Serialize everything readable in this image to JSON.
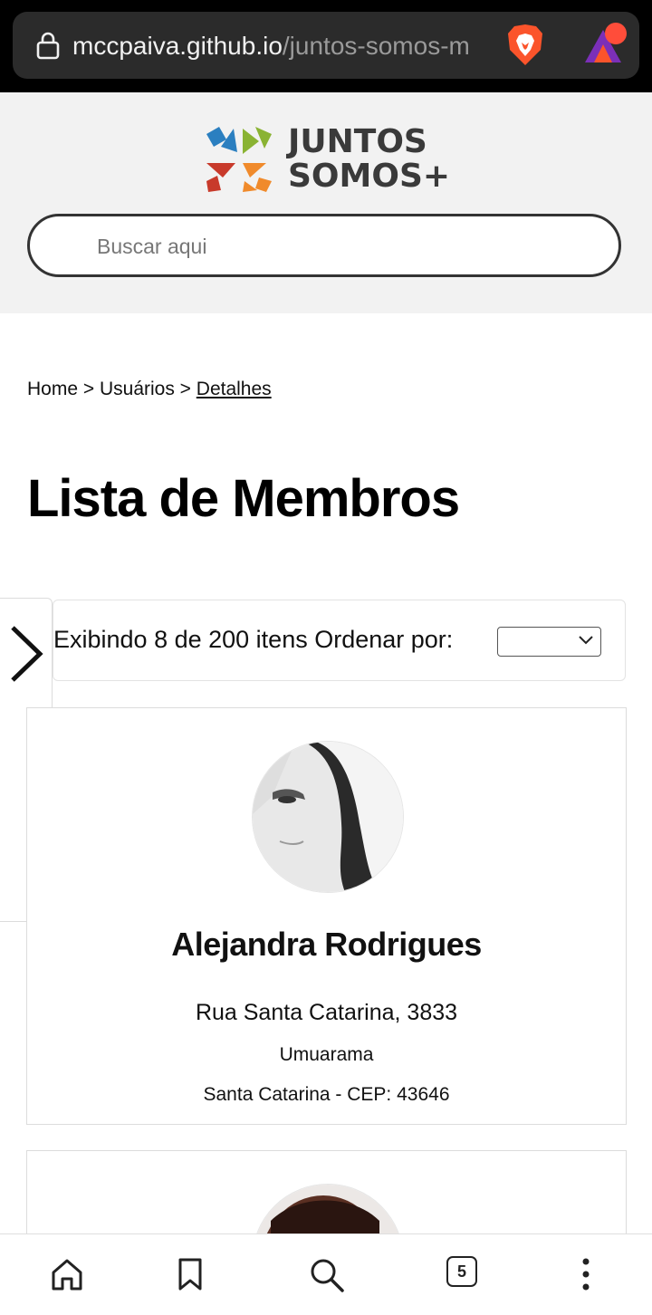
{
  "browser": {
    "url_host": "mccpaiva.github.io",
    "url_path": "/juntos-somos-m",
    "tab_count": "5",
    "icons": [
      "lock-icon",
      "brave-shield-icon",
      "brave-rewards-icon",
      "home-icon",
      "bookmark-icon",
      "search-icon",
      "tabs-icon",
      "more-icon"
    ]
  },
  "header": {
    "logo_line1": "JUNTOS",
    "logo_line2": "SOMOS+",
    "search_placeholder": "Buscar aqui",
    "logo_colors": [
      "#2b7fc0",
      "#8ab333",
      "#c83a2b",
      "#f08a2b"
    ]
  },
  "breadcrumb": {
    "home": "Home",
    "sep1": " > ",
    "users": "Usuários",
    "sep2": " > ",
    "current": "Detalhes"
  },
  "page": {
    "title": "Lista de Membros"
  },
  "filter": {
    "summary": "Exibindo 8 de 200 itens Ordenar por:",
    "sort_selected": ""
  },
  "members": [
    {
      "name": "Alejandra Rodrigues",
      "street": "Rua Santa Catarina, 3833",
      "city": "Umuarama",
      "state_cep": "Santa Catarina - CEP: 43646"
    }
  ]
}
